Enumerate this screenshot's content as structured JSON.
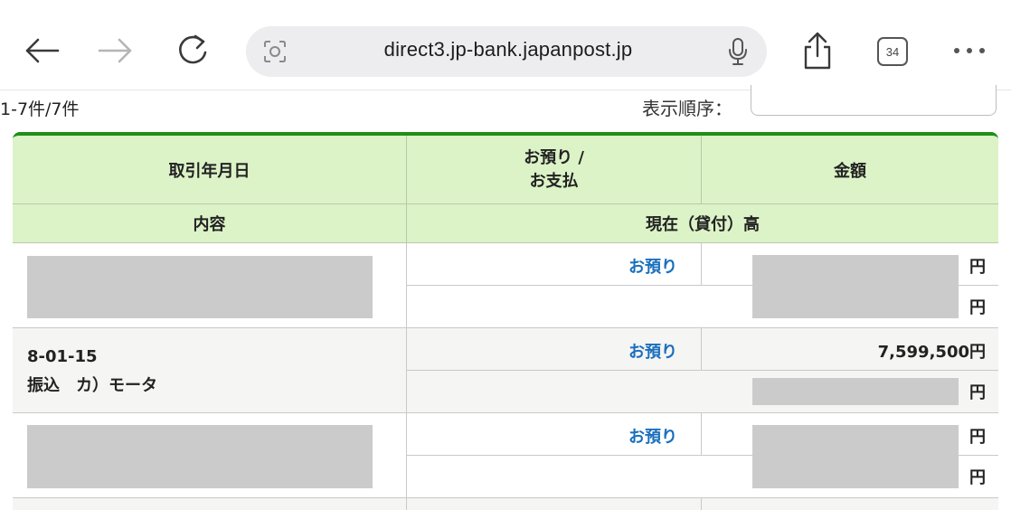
{
  "browser": {
    "url": "direct3.jp-bank.japanpost.jp",
    "tab_count": "34"
  },
  "page": {
    "count_text": "1-7件/7件",
    "sort_label": "表示順序："
  },
  "table": {
    "headers": {
      "date": "取引年月日",
      "type_line1": "お預り /",
      "type_line2": "お支払",
      "amount": "金額",
      "content": "内容",
      "balance": "現在（貸付）高"
    },
    "rows": [
      {
        "date": "",
        "description": "",
        "type": "お預り",
        "amount": "",
        "amount_unit": "円",
        "balance": "",
        "balance_unit": "円"
      },
      {
        "date": "8-01-15",
        "description": "振込　カ）モータ",
        "type": "お預り",
        "amount": "7,599,500円",
        "amount_unit": "",
        "balance": "",
        "balance_unit": "円"
      },
      {
        "date": "",
        "description": "",
        "type": "お預り",
        "amount": "",
        "amount_unit": "円",
        "balance": "",
        "balance_unit": "円"
      }
    ]
  },
  "colors": {
    "header_bg": "#dcf2c7",
    "header_border": "#1e8f17",
    "deposit_text": "#1a6fbd",
    "redaction": "#cbcbcb"
  }
}
